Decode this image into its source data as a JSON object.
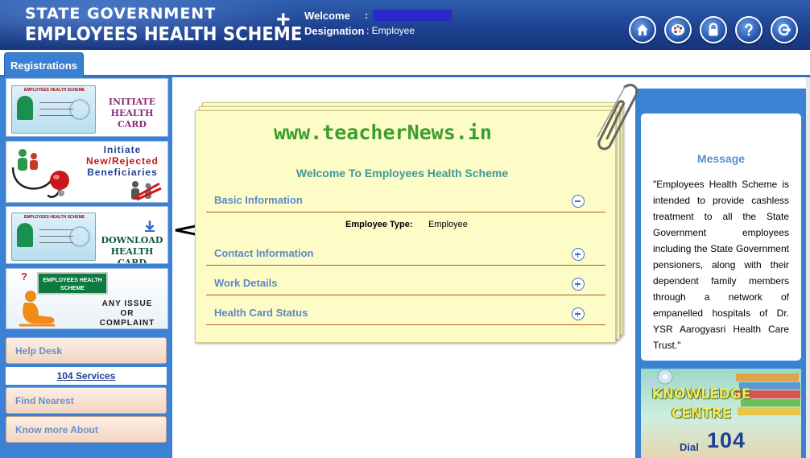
{
  "header": {
    "brand_line1": "STATE GOVERNMENT",
    "brand_line2": "EMPLOYEES HEALTH SCHEME",
    "welcome_label": "Welcome",
    "welcome_sep": ":",
    "designation_label": "Designation",
    "designation_value": ": Employee",
    "icons": [
      "home-icon",
      "palette-icon",
      "lock-icon",
      "help-icon",
      "logout-icon"
    ]
  },
  "tabs": [
    {
      "label": "Registrations"
    }
  ],
  "sidebar": {
    "cards": [
      {
        "name": "initiate-health-card",
        "caption_line1": "INITIATE",
        "caption_line2": "HEALTH CARD",
        "card_header": "EMPLOYEES HEALTH SCHEME"
      },
      {
        "name": "initiate-beneficiaries",
        "caption_line1": "Initiate",
        "caption_line2": "New/Rejected",
        "caption_line3": "Beneficiaries"
      },
      {
        "name": "download-health-card",
        "caption_line1": "DOWNLOAD",
        "caption_line2": "HEALTH CARD",
        "card_header": "EMPLOYEES HEALTH SCHEME"
      },
      {
        "name": "issue-complaint",
        "sign_line1": "EMPLOYEES HEALTH",
        "sign_line2": "SCHEME",
        "caption_line1": "ANY ISSUE",
        "caption_line2": "OR",
        "caption_line3": "COMPLAINT"
      }
    ],
    "help_desk": "Help Desk",
    "services_link": "104 Services",
    "find_nearest": "Find Nearest",
    "know_more": "Know more About"
  },
  "main": {
    "watermark": "www.teacherNews.in",
    "welcome_heading": "Welcome To Employees Health Scheme",
    "sections": [
      {
        "label": "Basic Information",
        "expanded": true
      },
      {
        "label": "Contact Information",
        "expanded": false
      },
      {
        "label": "Work Details",
        "expanded": false
      },
      {
        "label": "Health Card Status",
        "expanded": false
      }
    ],
    "employee_type_label": "Employee Type:",
    "employee_type_value": "Employee"
  },
  "message": {
    "title": "Message",
    "body": "\"Employees Health Scheme is intended to provide cashless treatment to all the State Government employees including the State Government pensioners, along with their dependent family members through a network of empanelled hospitals of Dr. YSR Aarogyasri Health Care Trust.\""
  },
  "knowledge": {
    "title_line1": "KNOWLEDGE",
    "title_line2": "CENTRE",
    "dial_label": "Dial",
    "dial_number": "104"
  },
  "colors": {
    "header_blue": "#1d3f8f",
    "panel_blue": "#3b82d5",
    "paper_yellow": "#fdfcc7",
    "accent_green": "#3a9e2e"
  }
}
